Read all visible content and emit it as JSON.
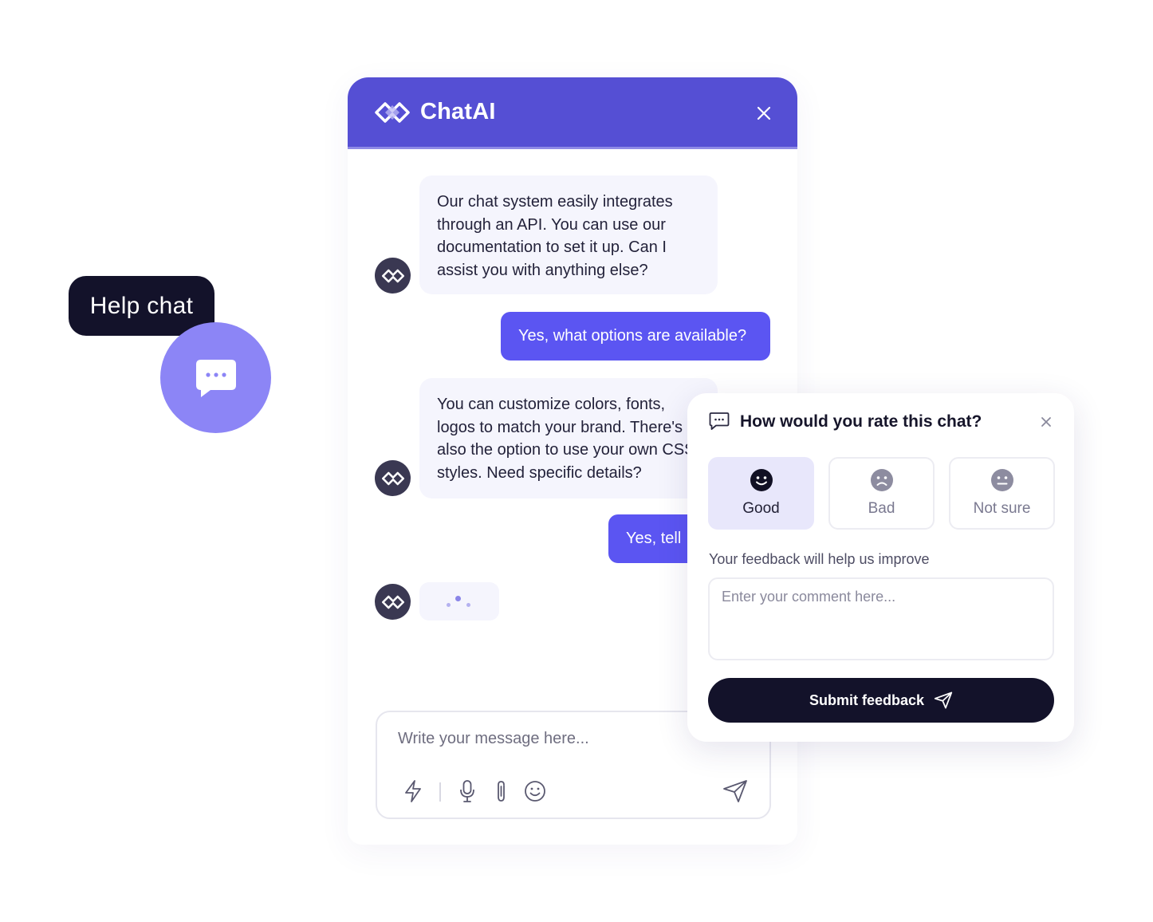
{
  "launcher": {
    "tooltip": "Help chat",
    "icon": "chat-bubble-icon",
    "color": "#8c85f6"
  },
  "chat": {
    "header": {
      "brand": "ChatAI",
      "color": "#554fd4"
    },
    "messages": [
      {
        "from": "bot",
        "text": "Our chat system easily integrates through an API. You can use our documentation to set it up. Can I assist you with anything else?"
      },
      {
        "from": "user",
        "text": "Yes, what options are available?"
      },
      {
        "from": "bot",
        "text": "You can customize colors, fonts, logos to match your brand. There's also the option to use your own CSS styles. Need specific details?"
      },
      {
        "from": "user",
        "text": "Yes, tell"
      }
    ],
    "typing": true,
    "composer": {
      "placeholder": "Write your message here...",
      "tools": [
        "lightning-icon",
        "microphone-icon",
        "paperclip-icon",
        "emoji-icon"
      ],
      "send_icon": "send-icon"
    }
  },
  "feedback": {
    "title": "How would you rate this chat?",
    "options": [
      {
        "label": "Good",
        "icon": "smile-icon",
        "selected": true
      },
      {
        "label": "Bad",
        "icon": "frown-icon",
        "selected": false
      },
      {
        "label": "Not sure",
        "icon": "neutral-face-icon",
        "selected": false
      }
    ],
    "hint": "Your feedback will help us improve",
    "comment_placeholder": "Enter your comment here...",
    "submit_label": "Submit feedback",
    "submit_color": "#13122a"
  },
  "colors": {
    "user_bubble": "#5b55f2",
    "bot_bubble": "#f5f5fd",
    "avatar": "#3a3852"
  }
}
